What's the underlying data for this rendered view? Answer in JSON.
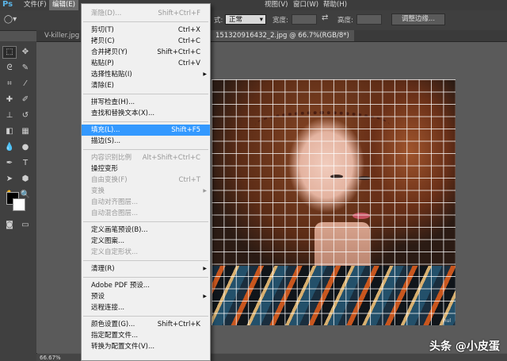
{
  "menubar": {
    "logo": "Ps",
    "items": [
      "文件(F)",
      "编辑(E)",
      "视图(V)",
      "窗口(W)",
      "帮助(H)"
    ]
  },
  "options": {
    "style_label": "式:",
    "style_value": "正常",
    "width_label": "宽度:",
    "height_label": "高度:",
    "adjust_edge": "调整边缘..."
  },
  "tabs": [
    "V-killer.jpg @",
    "151320916432_2.jpg @ 66.7%(RGB/8*)"
  ],
  "status": {
    "zoom": "66.67%"
  },
  "photo": {
    "caption": "hul"
  },
  "watermark": "头条 @小皮蛋",
  "menu": [
    {
      "label": "渐隐(D)...",
      "shortcut": "Shift+Ctrl+F",
      "disabled": true
    },
    {
      "sep": true
    },
    {
      "label": "剪切(T)",
      "shortcut": "Ctrl+X"
    },
    {
      "label": "拷贝(C)",
      "shortcut": "Ctrl+C"
    },
    {
      "label": "合并拷贝(Y)",
      "shortcut": "Shift+Ctrl+C"
    },
    {
      "label": "粘贴(P)",
      "shortcut": "Ctrl+V"
    },
    {
      "label": "选择性粘贴(I)",
      "shortcut": "",
      "submenu": true
    },
    {
      "label": "清除(E)",
      "shortcut": ""
    },
    {
      "sep": true
    },
    {
      "label": "拼写检查(H)...",
      "shortcut": ""
    },
    {
      "label": "查找和替换文本(X)...",
      "shortcut": ""
    },
    {
      "sep": true
    },
    {
      "label": "填充(L)...",
      "shortcut": "Shift+F5",
      "highlight": true
    },
    {
      "label": "描边(S)...",
      "shortcut": ""
    },
    {
      "sep": true
    },
    {
      "label": "内容识别比例",
      "shortcut": "Alt+Shift+Ctrl+C",
      "disabled": true
    },
    {
      "label": "操控变形",
      "shortcut": ""
    },
    {
      "label": "自由变换(F)",
      "shortcut": "Ctrl+T",
      "disabled": true
    },
    {
      "label": "变换",
      "shortcut": "",
      "submenu": true,
      "disabled": true
    },
    {
      "label": "自动对齐图层...",
      "shortcut": "",
      "disabled": true
    },
    {
      "label": "自动混合图层...",
      "shortcut": "",
      "disabled": true
    },
    {
      "sep": true
    },
    {
      "label": "定义画笔预设(B)...",
      "shortcut": ""
    },
    {
      "label": "定义图案...",
      "shortcut": ""
    },
    {
      "label": "定义自定形状...",
      "shortcut": "",
      "disabled": true
    },
    {
      "sep": true
    },
    {
      "label": "清理(R)",
      "shortcut": "",
      "submenu": true
    },
    {
      "sep": true
    },
    {
      "label": "Adobe PDF 预设...",
      "shortcut": ""
    },
    {
      "label": "预设",
      "shortcut": "",
      "submenu": true
    },
    {
      "label": "远程连接...",
      "shortcut": ""
    },
    {
      "sep": true
    },
    {
      "label": "颜色设置(G)...",
      "shortcut": "Shift+Ctrl+K"
    },
    {
      "label": "指定配置文件...",
      "shortcut": ""
    },
    {
      "label": "转换为配置文件(V)...",
      "shortcut": ""
    }
  ]
}
